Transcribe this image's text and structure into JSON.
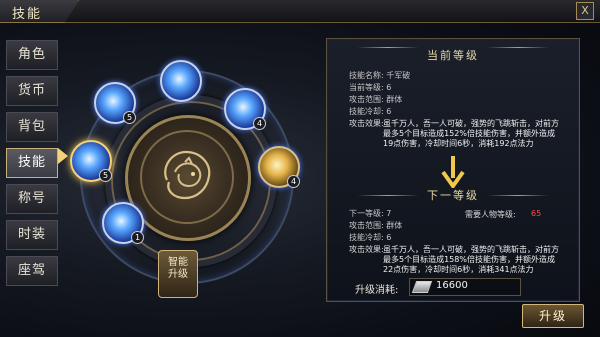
{
  "header": {
    "title": "技能",
    "close_label": "X"
  },
  "sidebar": {
    "items": [
      {
        "label": "角色",
        "active": false
      },
      {
        "label": "货币",
        "active": false
      },
      {
        "label": "背包",
        "active": false
      },
      {
        "label": "技能",
        "active": true
      },
      {
        "label": "称号",
        "active": false
      },
      {
        "label": "时装",
        "active": false
      },
      {
        "label": "座驾",
        "active": false
      }
    ]
  },
  "wheel": {
    "smart_upgrade_label_1": "智能",
    "smart_upgrade_label_2": "升级",
    "skill_levels": [
      "5",
      "5",
      "4",
      "4",
      "1"
    ]
  },
  "current": {
    "section_title": "当前等级",
    "name_label": "技能名称:",
    "name_value": "千军破",
    "level_label": "当前等级:",
    "level_value": "6",
    "range_label": "攻击范围:",
    "range_value": "群体",
    "cooldown_label": "技能冷却:",
    "cooldown_value": "6",
    "effect_label": "攻击效果:",
    "effect_value": "虽千万人，吾一人可破，强势的飞跳斩击，对前方最多5个目标造成152%倍技能伤害，并额外造成19点伤害，冷却时间6秒，消耗192点法力"
  },
  "next": {
    "section_title": "下一等级",
    "level_label": "下一等级:",
    "level_value": "7",
    "need_label": "需要人物等级:",
    "need_value": "65",
    "range_label": "攻击范围:",
    "range_value": "群体",
    "cooldown_label": "技能冷却:",
    "cooldown_value": "6",
    "effect_label": "攻击效果:",
    "effect_value": "虽千万人，吾一人可破，强势的飞跳斩击，对前方最多5个目标造成158%倍技能伤害，并额外造成22点伤害，冷却时间6秒，消耗341点法力"
  },
  "cost": {
    "label": "升级消耗:",
    "value": "16600"
  },
  "actions": {
    "upgrade_label": "升级"
  }
}
